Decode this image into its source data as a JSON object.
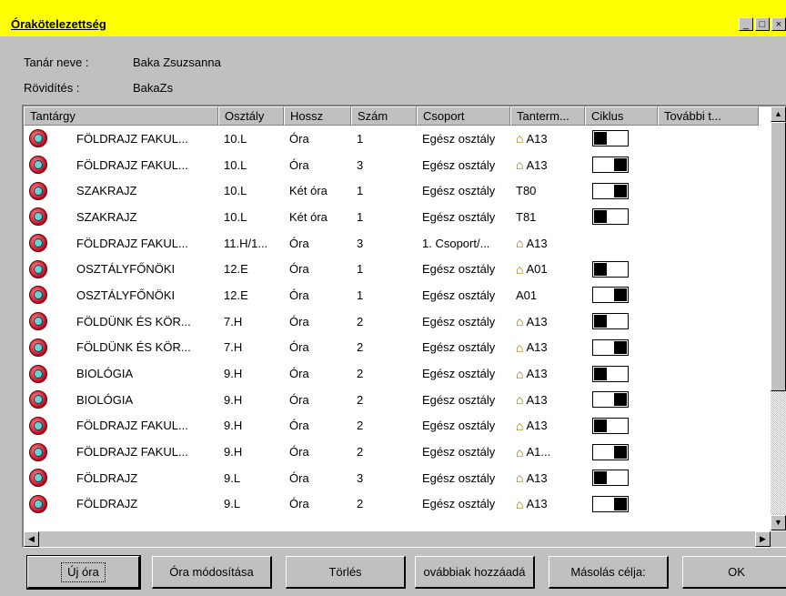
{
  "window": {
    "title": "Órakötelezettség",
    "minimize_label": "_",
    "maximize_label": "□",
    "close_label": "×"
  },
  "info": {
    "teacher_label": "Tanár neve :",
    "teacher_value": "Baka Zsuzsanna",
    "abbr_label": "Rövidítés :",
    "abbr_value": "BakaZs"
  },
  "table": {
    "columns": [
      "Tantárgy",
      "Osztály",
      "Hossz",
      "Szám",
      "Csoport",
      "Tanterm...",
      "Ciklus",
      "További t..."
    ],
    "rows": [
      {
        "subject": "FÖLDRAJZ FAKUL...",
        "class": "10.L",
        "length": "Óra",
        "count": "1",
        "group": "Egész osztály",
        "room": "A13",
        "room_icon": true,
        "cycle": "left"
      },
      {
        "subject": "FÖLDRAJZ FAKUL...",
        "class": "10.L",
        "length": "Óra",
        "count": "3",
        "group": "Egész osztály",
        "room": "A13",
        "room_icon": true,
        "cycle": "right"
      },
      {
        "subject": "SZAKRAJZ",
        "class": "10.L",
        "length": "Két óra",
        "count": "1",
        "group": "Egész osztály",
        "room": "T80",
        "room_icon": false,
        "cycle": "right"
      },
      {
        "subject": "SZAKRAJZ",
        "class": "10.L",
        "length": "Két óra",
        "count": "1",
        "group": "Egész osztály",
        "room": "T81",
        "room_icon": false,
        "cycle": "left"
      },
      {
        "subject": "FÖLDRAJZ FAKUL...",
        "class": "11.H/1...",
        "length": "Óra",
        "count": "3",
        "group": "1. Csoport/...",
        "room": "A13",
        "room_icon": true,
        "cycle": "none"
      },
      {
        "subject": "OSZTÁLYFŐNÖKI",
        "class": "12.E",
        "length": "Óra",
        "count": "1",
        "group": "Egész osztály",
        "room": "A01",
        "room_icon": true,
        "cycle": "left"
      },
      {
        "subject": "OSZTÁLYFŐNÖKI",
        "class": "12.E",
        "length": "Óra",
        "count": "1",
        "group": "Egész osztály",
        "room": "A01",
        "room_icon": false,
        "cycle": "right"
      },
      {
        "subject": "FÖLDÜNK ÉS KÖR...",
        "class": "7.H",
        "length": "Óra",
        "count": "2",
        "group": "Egész osztály",
        "room": "A13",
        "room_icon": true,
        "cycle": "left"
      },
      {
        "subject": "FÖLDÜNK ÉS KÖR...",
        "class": "7.H",
        "length": "Óra",
        "count": "2",
        "group": "Egész osztály",
        "room": "A13",
        "room_icon": true,
        "cycle": "right"
      },
      {
        "subject": "BIOLÓGIA",
        "class": "9.H",
        "length": "Óra",
        "count": "2",
        "group": "Egész osztály",
        "room": "A13",
        "room_icon": true,
        "cycle": "left"
      },
      {
        "subject": "BIOLÓGIA",
        "class": "9.H",
        "length": "Óra",
        "count": "2",
        "group": "Egész osztály",
        "room": "A13",
        "room_icon": true,
        "cycle": "right"
      },
      {
        "subject": "FÖLDRAJZ FAKUL...",
        "class": "9.H",
        "length": "Óra",
        "count": "2",
        "group": "Egész osztály",
        "room": "A13",
        "room_icon": true,
        "cycle": "left"
      },
      {
        "subject": "FÖLDRAJZ FAKUL...",
        "class": "9.H",
        "length": "Óra",
        "count": "2",
        "group": "Egész osztály",
        "room": "A1...",
        "room_icon": true,
        "cycle": "right"
      },
      {
        "subject": "FÖLDRAJZ",
        "class": "9.L",
        "length": "Óra",
        "count": "3",
        "group": "Egész osztály",
        "room": "A13",
        "room_icon": true,
        "cycle": "left"
      },
      {
        "subject": "FÖLDRAJZ",
        "class": "9.L",
        "length": "Óra",
        "count": "2",
        "group": "Egész osztály",
        "room": "A13",
        "room_icon": true,
        "cycle": "right"
      }
    ]
  },
  "buttons": {
    "new": "Új óra",
    "edit": "Óra módosítása",
    "delete": "Törlés",
    "add_more": "ovábbiak hozzáadá",
    "copy_target": "Másolás célja:",
    "ok": "OK"
  },
  "icons": {
    "row_icon": "clock-icon",
    "room_icon": "house-icon"
  }
}
